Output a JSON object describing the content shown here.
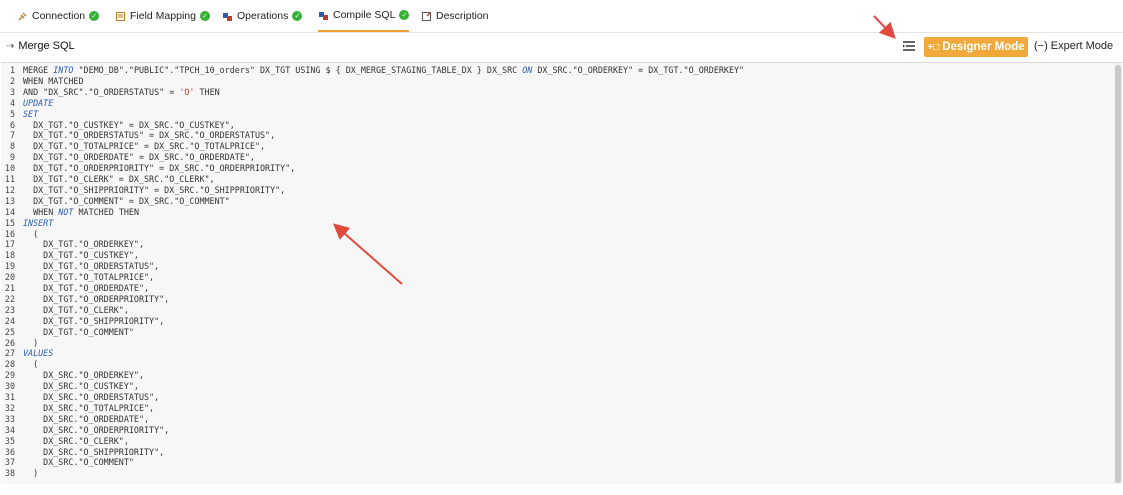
{
  "tabs": [
    {
      "label": "Connection",
      "icon": "plug-icon",
      "status": "complete"
    },
    {
      "label": "Field Mapping",
      "icon": "field-mapping-icon",
      "status": "complete"
    },
    {
      "label": "Operations",
      "icon": "operations-icon",
      "status": "complete"
    },
    {
      "label": "Compile SQL",
      "icon": "compile-sql-icon",
      "status": "complete",
      "active": true
    },
    {
      "label": "Description",
      "icon": "description-icon"
    }
  ],
  "header": {
    "title": "Merge SQL",
    "title_icon": "merge-icon",
    "designer_mode_label": "Designer Mode",
    "expert_mode_label": "Expert Mode"
  },
  "colors": {
    "accent": "#f0a93a",
    "check": "#34b233",
    "keyword": "#2a5db0",
    "string": "#c0392b",
    "annotation_arrow": "#e04a3f"
  },
  "code_lines": [
    {
      "n": "1",
      "segs": [
        [
          "MERGE ",
          ""
        ],
        [
          "INTO",
          "kw"
        ],
        [
          " \"DEMO_DB\".\"PUBLIC\".\"TPCH_10_orders\" DX_TGT USING $ { DX_MERGE_STAGING_TABLE_DX } DX_SRC ",
          ""
        ],
        [
          "ON",
          "kw"
        ],
        [
          " DX_SRC.\"O_ORDERKEY\" = DX_TGT.\"O_ORDERKEY\"",
          ""
        ]
      ]
    },
    {
      "n": "2",
      "segs": [
        [
          "WHEN MATCHED",
          ""
        ]
      ]
    },
    {
      "n": "3",
      "segs": [
        [
          "AND \"DX_SRC\".\"O_ORDERSTATUS\" = ",
          ""
        ],
        [
          "'O'",
          "str"
        ],
        [
          " THEN",
          ""
        ]
      ]
    },
    {
      "n": "4",
      "segs": [
        [
          "UPDATE",
          "kw"
        ]
      ]
    },
    {
      "n": "5",
      "segs": [
        [
          "SET",
          "kw"
        ]
      ]
    },
    {
      "n": "6",
      "segs": [
        [
          "  DX_TGT.\"O_CUSTKEY\" = DX_SRC.\"O_CUSTKEY\",",
          ""
        ]
      ]
    },
    {
      "n": "7",
      "segs": [
        [
          "  DX_TGT.\"O_ORDERSTATUS\" = DX_SRC.\"O_ORDERSTATUS\",",
          ""
        ]
      ]
    },
    {
      "n": "8",
      "segs": [
        [
          "  DX_TGT.\"O_TOTALPRICE\" = DX_SRC.\"O_TOTALPRICE\",",
          ""
        ]
      ]
    },
    {
      "n": "9",
      "segs": [
        [
          "  DX_TGT.\"O_ORDERDATE\" = DX_SRC.\"O_ORDERDATE\",",
          ""
        ]
      ]
    },
    {
      "n": "10",
      "segs": [
        [
          "  DX_TGT.\"O_ORDERPRIORITY\" = DX_SRC.\"O_ORDERPRIORITY\",",
          ""
        ]
      ]
    },
    {
      "n": "11",
      "segs": [
        [
          "  DX_TGT.\"O_CLERK\" = DX_SRC.\"O_CLERK\",",
          ""
        ]
      ]
    },
    {
      "n": "12",
      "segs": [
        [
          "  DX_TGT.\"O_SHIPPRIORITY\" = DX_SRC.\"O_SHIPPRIORITY\",",
          ""
        ]
      ]
    },
    {
      "n": "13",
      "segs": [
        [
          "  DX_TGT.\"O_COMMENT\" = DX_SRC.\"O_COMMENT\"",
          ""
        ]
      ]
    },
    {
      "n": "14",
      "segs": [
        [
          "  WHEN ",
          ""
        ],
        [
          "NOT",
          "kw"
        ],
        [
          " MATCHED THEN",
          ""
        ]
      ]
    },
    {
      "n": "15",
      "segs": [
        [
          "INSERT",
          "kw"
        ]
      ]
    },
    {
      "n": "16",
      "segs": [
        [
          "  (",
          ""
        ]
      ]
    },
    {
      "n": "17",
      "segs": [
        [
          "    DX_TGT.\"O_ORDERKEY\",",
          ""
        ]
      ]
    },
    {
      "n": "18",
      "segs": [
        [
          "    DX_TGT.\"O_CUSTKEY\",",
          ""
        ]
      ]
    },
    {
      "n": "19",
      "segs": [
        [
          "    DX_TGT.\"O_ORDERSTATUS\",",
          ""
        ]
      ]
    },
    {
      "n": "20",
      "segs": [
        [
          "    DX_TGT.\"O_TOTALPRICE\",",
          ""
        ]
      ]
    },
    {
      "n": "21",
      "segs": [
        [
          "    DX_TGT.\"O_ORDERDATE\",",
          ""
        ]
      ]
    },
    {
      "n": "22",
      "segs": [
        [
          "    DX_TGT.\"O_ORDERPRIORITY\",",
          ""
        ]
      ]
    },
    {
      "n": "23",
      "segs": [
        [
          "    DX_TGT.\"O_CLERK\",",
          ""
        ]
      ]
    },
    {
      "n": "24",
      "segs": [
        [
          "    DX_TGT.\"O_SHIPPRIORITY\",",
          ""
        ]
      ]
    },
    {
      "n": "25",
      "segs": [
        [
          "    DX_TGT.\"O_COMMENT\"",
          ""
        ]
      ]
    },
    {
      "n": "26",
      "segs": [
        [
          "  )",
          ""
        ]
      ]
    },
    {
      "n": "27",
      "segs": [
        [
          "VALUES",
          "kw"
        ]
      ]
    },
    {
      "n": "28",
      "segs": [
        [
          "  (",
          ""
        ]
      ]
    },
    {
      "n": "29",
      "segs": [
        [
          "    DX_SRC.\"O_ORDERKEY\",",
          ""
        ]
      ]
    },
    {
      "n": "30",
      "segs": [
        [
          "    DX_SRC.\"O_CUSTKEY\",",
          ""
        ]
      ]
    },
    {
      "n": "31",
      "segs": [
        [
          "    DX_SRC.\"O_ORDERSTATUS\",",
          ""
        ]
      ]
    },
    {
      "n": "32",
      "segs": [
        [
          "    DX_SRC.\"O_TOTALPRICE\",",
          ""
        ]
      ]
    },
    {
      "n": "33",
      "segs": [
        [
          "    DX_SRC.\"O_ORDERDATE\",",
          ""
        ]
      ]
    },
    {
      "n": "34",
      "segs": [
        [
          "    DX_SRC.\"O_ORDERPRIORITY\",",
          ""
        ]
      ]
    },
    {
      "n": "35",
      "segs": [
        [
          "    DX_SRC.\"O_CLERK\",",
          ""
        ]
      ]
    },
    {
      "n": "36",
      "segs": [
        [
          "    DX_SRC.\"O_SHIPPRIORITY\",",
          ""
        ]
      ]
    },
    {
      "n": "37",
      "segs": [
        [
          "    DX_SRC.\"O_COMMENT\"",
          ""
        ]
      ]
    },
    {
      "n": "38",
      "segs": [
        [
          "  )",
          ""
        ]
      ]
    }
  ]
}
